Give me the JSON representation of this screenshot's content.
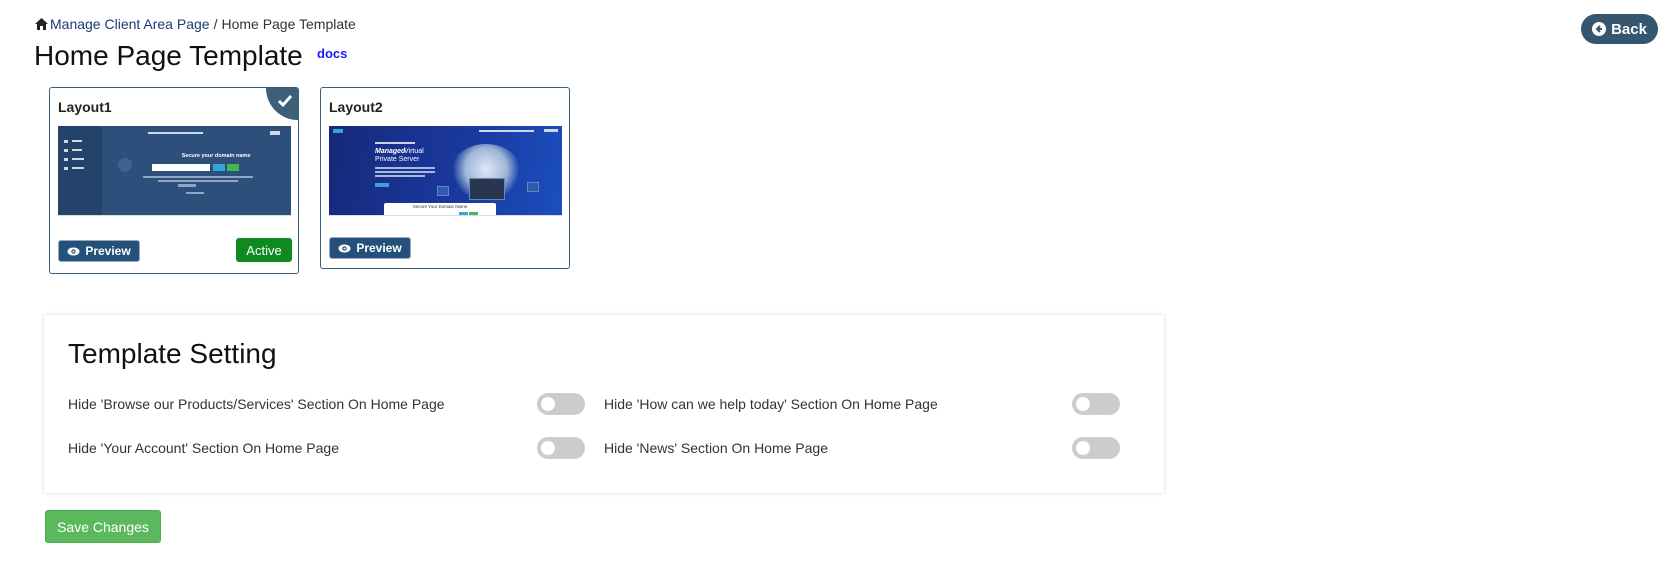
{
  "breadcrumb": {
    "parent": "Manage Client Area Page",
    "separator": "/",
    "current": "Home Page Template"
  },
  "header": {
    "title": "Home Page Template",
    "docs_label": "docs",
    "back_label": "Back"
  },
  "layouts": [
    {
      "name": "Layout1",
      "preview_label": "Preview",
      "status": "Active",
      "selected": true,
      "thumbnail": {
        "hero_text": "Secure your domain name"
      }
    },
    {
      "name": "Layout2",
      "preview_label": "Preview",
      "selected": false,
      "thumbnail": {
        "hero_emphasis": "Managed",
        "hero_line1": "Virtual",
        "hero_line2": "Private Server",
        "domain_box_text": "Secure Your Domain Name"
      }
    }
  ],
  "settings": {
    "title": "Template Setting",
    "options": [
      {
        "label": "Hide 'Browse our Products/Services' Section On Home Page",
        "enabled": false
      },
      {
        "label": "Hide 'How can we help today' Section On Home Page",
        "enabled": false
      },
      {
        "label": "Hide 'Your Account' Section On Home Page",
        "enabled": false
      },
      {
        "label": "Hide 'News' Section On Home Page",
        "enabled": false
      }
    ]
  },
  "save_label": "Save Changes",
  "colors": {
    "back_button": "#35566e",
    "active_badge": "#0f8a1e",
    "save_button": "#5cb85c",
    "preview_button": "#23517a",
    "toggle_off": "#cccccc"
  }
}
